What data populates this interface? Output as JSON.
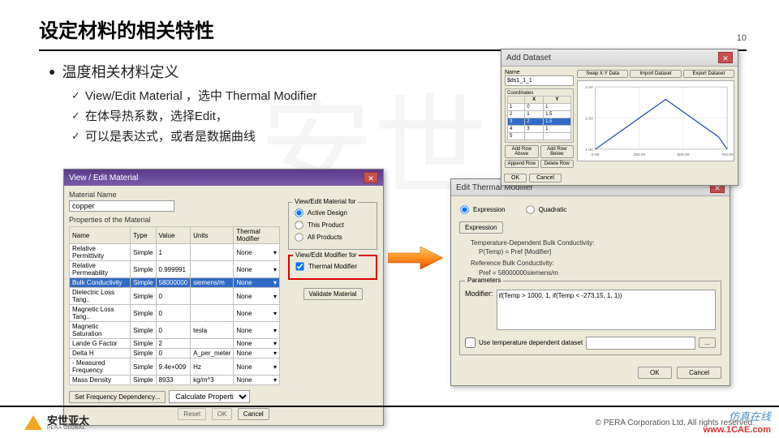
{
  "page_number": "10",
  "title": "设定材料的相关特性",
  "bullets": {
    "main": "温度相关材料定义",
    "sub1": "View/Edit Material ，选中 Thermal Modifier",
    "sub2": "在体导热系数，选择Edit，",
    "sub3": "可以是表达式，或者是数据曲线"
  },
  "dlg1": {
    "title": "View / Edit Material",
    "material_name_label": "Material Name",
    "material_name": "copper",
    "props_label": "Properties of the Material",
    "headers": [
      "Name",
      "Type",
      "Value",
      "Units",
      "Thermal Modifier"
    ],
    "rows": [
      [
        "Relative Permittivity",
        "Simple",
        "1",
        "",
        "None"
      ],
      [
        "Relative Permeability",
        "Simple",
        "0.999991",
        "",
        "None"
      ],
      [
        "Bulk Conductivity",
        "Simple",
        "58000000",
        "siemens/m",
        "None"
      ],
      [
        "Dielectric Loss Tang..",
        "Simple",
        "0",
        "",
        "None"
      ],
      [
        "Magnetic Loss Tang..",
        "Simple",
        "0",
        "",
        "None"
      ],
      [
        "Magnetic Saturation",
        "Simple",
        "0",
        "tesla",
        "None"
      ],
      [
        "Lande G Factor",
        "Simple",
        "2",
        "",
        "None"
      ],
      [
        "Delta H",
        "Simple",
        "0",
        "A_per_meter",
        "None"
      ],
      [
        "- Measured Frequency",
        "Simple",
        "9.4e+009",
        "Hz",
        "None"
      ],
      [
        "Mass Density",
        "Simple",
        "8933",
        "kg/m^3",
        "None"
      ]
    ],
    "view_for_label": "View/Edit Material for",
    "radio1": "Active Design",
    "radio2": "This Product",
    "radio3": "All Products",
    "mod_for_label": "View/Edit Modifier for",
    "thermal_check": "Thermal Modifier",
    "validate_btn": "Validate Material",
    "set_freq_btn": "Set Frequency Dependency...",
    "calc_label": "Calculate Properties for",
    "reset_btn": "Reset",
    "ok_btn": "OK",
    "cancel_btn": "Cancel"
  },
  "dlg2": {
    "title": "Edit Thermal Modifier",
    "radio_expr": "Expression",
    "radio_quad": "Quadratic",
    "expr_btn": "Expression",
    "info1": "Temperature-Dependent Bulk Conductivity:",
    "info1b": "P(Temp) = Pref [Modifier]",
    "info2": "Reference Bulk Conductivity:",
    "info2b": "Pref = 58000000siemens/m",
    "params_label": "Parameters",
    "modifier_label": "Modifier:",
    "modifier_val": "if(Temp > 1000, 1, if(Temp < -273.15, 1, 1))",
    "use_dataset": "Use temperature dependent dataset",
    "browse": "...",
    "ok_btn": "OK",
    "cancel_btn": "Cancel"
  },
  "dlg3": {
    "title": "Add Dataset",
    "name_label": "Name",
    "name_val": "$ds1_1_1",
    "btns_top": [
      "Swap X-Y Data",
      "Import Dataset",
      "Export Dataset"
    ],
    "coord_label": "Coordinates",
    "coord_headers": [
      "",
      "X",
      "Y"
    ],
    "rows": [
      [
        "1",
        "0",
        "1"
      ],
      [
        "2",
        "1",
        "1.5"
      ],
      [
        "3",
        "2",
        "1.5"
      ],
      [
        "4",
        "3",
        "1"
      ],
      [
        "5",
        "",
        ""
      ]
    ],
    "btns_mid": [
      "Add Row Above",
      "Add Row Below",
      "Append Row",
      "Delete Row"
    ],
    "ok_btn": "OK",
    "cancel_btn": "Cancel"
  },
  "chart_data": {
    "type": "line",
    "x": [
      0,
      100,
      200,
      300,
      400,
      500,
      600,
      700,
      750
    ],
    "y": [
      1.0,
      1.2,
      1.4,
      1.6,
      1.8,
      1.6,
      1.4,
      1.2,
      1.0
    ],
    "xlim": [
      0,
      750
    ],
    "ylim": [
      1.0,
      2.0
    ],
    "xticks": [
      0,
      250,
      500,
      750
    ],
    "yticks": [
      1.0,
      1.5,
      2.0
    ],
    "color": "#1a4aa0"
  },
  "footer": {
    "logo_name": "安世亚太",
    "logo_sub": "PERA GLOBAL",
    "copyright": "© PERA Corporation Ltd. All rights reserved."
  },
  "watermark1": "仿真在线",
  "watermark2": "www.1CAE.com"
}
